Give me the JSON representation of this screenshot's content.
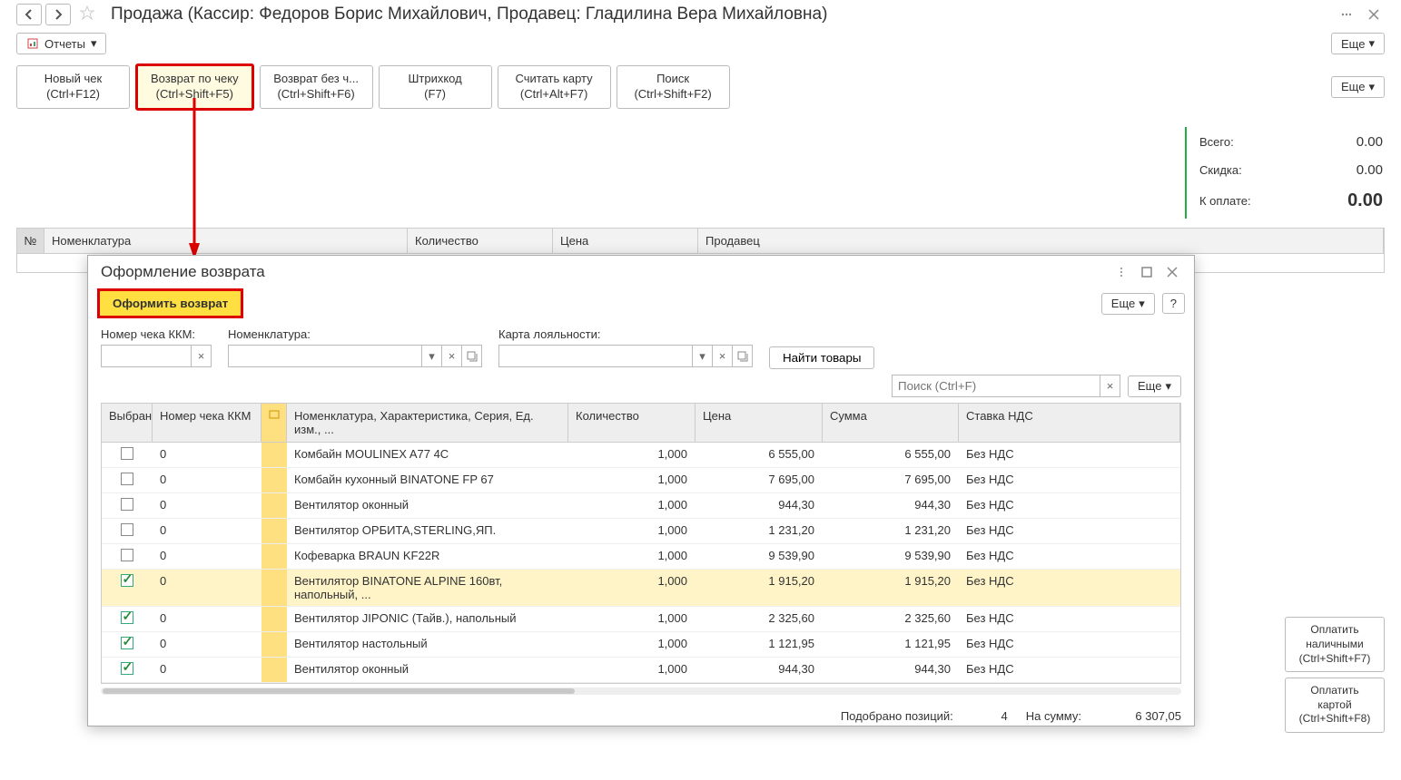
{
  "page_title": "Продажа (Кассир: Федоров Борис Михайлович, Продавец: Гладилина Вера Михайловна)",
  "reports_label": "Отчеты",
  "more_label": "Еще",
  "actions": [
    {
      "name": "new-check",
      "line1": "Новый чек",
      "line2": "(Ctrl+F12)"
    },
    {
      "name": "return-by-check",
      "line1": "Возврат по чеку",
      "line2": "(Ctrl+Shift+F5)"
    },
    {
      "name": "return-no-check",
      "line1": "Возврат без ч...",
      "line2": "(Ctrl+Shift+F6)"
    },
    {
      "name": "barcode",
      "line1": "Штрихкод",
      "line2": "(F7)"
    },
    {
      "name": "read-card",
      "line1": "Считать карту",
      "line2": "(Ctrl+Alt+F7)"
    },
    {
      "name": "search",
      "line1": "Поиск",
      "line2": "(Ctrl+Shift+F2)"
    }
  ],
  "status": {
    "total_label": "Всего:",
    "total_value": "0.00",
    "discount_label": "Скидка:",
    "discount_value": "0.00",
    "due_label": "К оплате:",
    "due_value": "0.00"
  },
  "main_headers": {
    "num": "№",
    "nom": "Номенклатура",
    "qty": "Количество",
    "price": "Цена",
    "seller": "Продавец"
  },
  "dialog": {
    "title": "Оформление возврата",
    "btn_return": "Оформить возврат",
    "more": "Еще",
    "help": "?",
    "field_kkm": "Номер чека ККМ:",
    "field_nom": "Номенклатура:",
    "field_card": "Карта лояльности:",
    "btn_find": "Найти товары",
    "search_placeholder": "Поиск (Ctrl+F)",
    "headers": {
      "chk": "Выбран",
      "kkm": "Номер чека ККМ",
      "nom": "Номенклатура, Характеристика, Серия, Ед. изм., ...",
      "qty": "Количество",
      "price": "Цена",
      "sum": "Сумма",
      "vat": "Ставка НДС"
    },
    "rows": [
      {
        "chk": false,
        "kkm": "0",
        "nom": "Комбайн MOULINEX  A77 4C",
        "qty": "1,000",
        "price": "6 555,00",
        "sum": "6 555,00",
        "vat": "Без НДС"
      },
      {
        "chk": false,
        "kkm": "0",
        "nom": "Комбайн кухонный BINATONE FP 67",
        "qty": "1,000",
        "price": "7 695,00",
        "sum": "7 695,00",
        "vat": "Без НДС"
      },
      {
        "chk": false,
        "kkm": "0",
        "nom": "Вентилятор оконный",
        "qty": "1,000",
        "price": "944,30",
        "sum": "944,30",
        "vat": "Без НДС"
      },
      {
        "chk": false,
        "kkm": "0",
        "nom": "Вентилятор ОРБИТА,STERLING,ЯП.",
        "qty": "1,000",
        "price": "1 231,20",
        "sum": "1 231,20",
        "vat": "Без НДС"
      },
      {
        "chk": false,
        "kkm": "0",
        "nom": "Кофеварка BRAUN KF22R",
        "qty": "1,000",
        "price": "9 539,90",
        "sum": "9 539,90",
        "vat": "Без НДС"
      },
      {
        "chk": true,
        "kkm": "0",
        "nom": "Вентилятор BINATONE ALPINE 160вт, напольный, ...",
        "qty": "1,000",
        "price": "1 915,20",
        "sum": "1 915,20",
        "vat": "Без НДС",
        "sel": true
      },
      {
        "chk": true,
        "kkm": "0",
        "nom": "Вентилятор JIPONIC (Тайв.), напольный",
        "qty": "1,000",
        "price": "2 325,60",
        "sum": "2 325,60",
        "vat": "Без НДС"
      },
      {
        "chk": true,
        "kkm": "0",
        "nom": "Вентилятор настольный",
        "qty": "1,000",
        "price": "1 121,95",
        "sum": "1 121,95",
        "vat": "Без НДС"
      },
      {
        "chk": true,
        "kkm": "0",
        "nom": "Вентилятор оконный",
        "qty": "1,000",
        "price": "944,30",
        "sum": "944,30",
        "vat": "Без НДС"
      }
    ],
    "footer": {
      "count_label": "Подобрано позиций:",
      "count_value": "4",
      "sum_label": "На сумму:",
      "sum_value": "6 307,05"
    }
  },
  "pay": {
    "cash1": "Оплатить",
    "cash2": "наличными",
    "cash3": "(Ctrl+Shift+F7)",
    "card1": "Оплатить",
    "card2": "картой",
    "card3": "(Ctrl+Shift+F8)"
  }
}
